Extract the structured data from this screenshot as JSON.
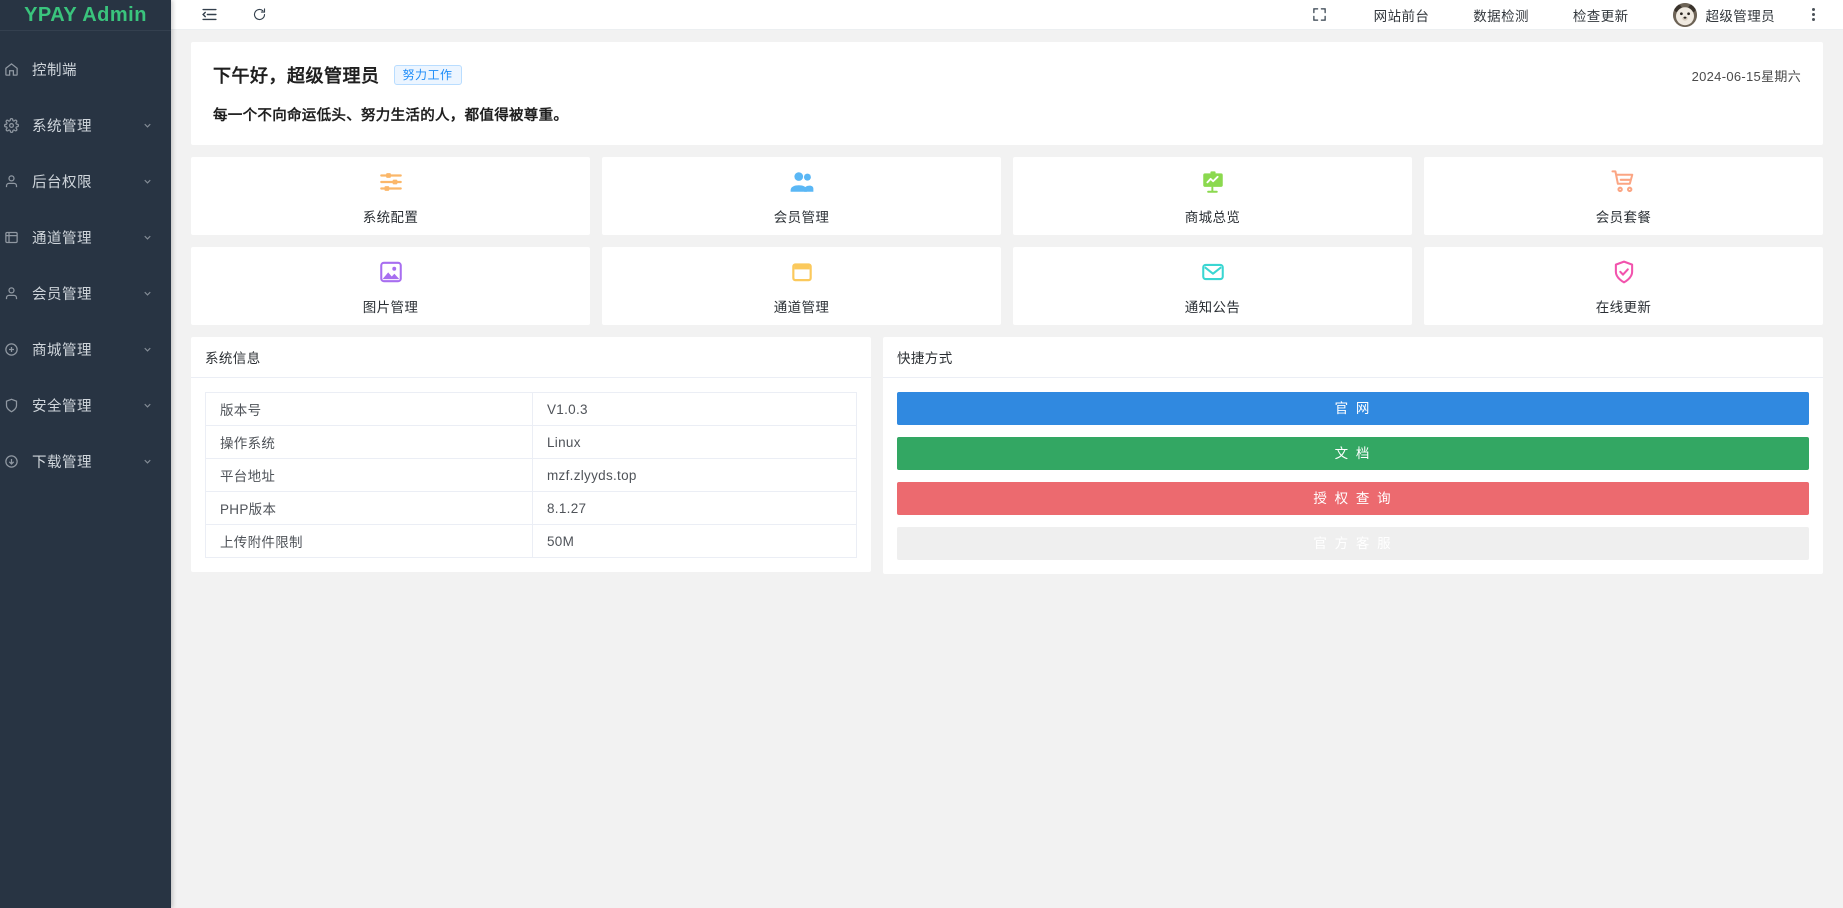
{
  "sidebar": {
    "brand": "YPAY Admin",
    "items": [
      {
        "label": "控制端",
        "icon": "home-icon",
        "expandable": false
      },
      {
        "label": "系统管理",
        "icon": "gear-icon",
        "expandable": true
      },
      {
        "label": "后台权限",
        "icon": "user-lock-icon",
        "expandable": true
      },
      {
        "label": "通道管理",
        "icon": "channel-icon",
        "expandable": true
      },
      {
        "label": "会员管理",
        "icon": "user-icon",
        "expandable": true
      },
      {
        "label": "商城管理",
        "icon": "shop-icon",
        "expandable": true
      },
      {
        "label": "安全管理",
        "icon": "shield-icon",
        "expandable": true
      },
      {
        "label": "下载管理",
        "icon": "download-icon",
        "expandable": true
      }
    ]
  },
  "navbar": {
    "collapse_icon": "menu-collapse-icon",
    "refresh_icon": "refresh-icon",
    "fullscreen_icon": "fullscreen-icon",
    "links": [
      "网站前台",
      "数据检测",
      "检查更新"
    ],
    "username": "超级管理员",
    "avatar_icon": "bear-avatar",
    "more_icon": "more-vertical-icon"
  },
  "greeting": {
    "title": "下午好，超级管理员",
    "badge": "努力工作",
    "subtitle": "每一个不向命运低头、努力生活的人，都值得被尊重。",
    "date": "2024-06-15星期六"
  },
  "tiles": [
    {
      "label": "系统配置",
      "icon": "sliders-icon",
      "color": "#fbb769"
    },
    {
      "label": "会员管理",
      "icon": "users-icon",
      "color": "#5ab7f5"
    },
    {
      "label": "商城总览",
      "icon": "chart-board-icon",
      "color": "#8bd94f"
    },
    {
      "label": "会员套餐",
      "icon": "shopping-cart-icon",
      "color": "#fba583"
    },
    {
      "label": "图片管理",
      "icon": "image-icon",
      "color": "#a86ef0"
    },
    {
      "label": "通道管理",
      "icon": "folder-icon",
      "color": "#fbc95c"
    },
    {
      "label": "通知公告",
      "icon": "envelope-icon",
      "color": "#3ad6d2"
    },
    {
      "label": "在线更新",
      "icon": "shield-check-icon",
      "color": "#f253ad"
    }
  ],
  "sysinfo": {
    "title": "系统信息",
    "rows": [
      {
        "key": "版本号",
        "value": "V1.0.3"
      },
      {
        "key": "操作系统",
        "value": "Linux"
      },
      {
        "key": "平台地址",
        "value": "mzf.zlyyds.top"
      },
      {
        "key": "PHP版本",
        "value": "8.1.27"
      },
      {
        "key": "上传附件限制",
        "value": "50M"
      }
    ]
  },
  "quick": {
    "title": "快捷方式",
    "buttons": [
      {
        "label": "官 网",
        "color": "#3089e0"
      },
      {
        "label": "文 档",
        "color": "#33a763"
      },
      {
        "label": "授 权 查 询",
        "color": "#ec6a6f"
      },
      {
        "label": "官 方 客 服",
        "color": "#f0a council"
      }
    ]
  }
}
